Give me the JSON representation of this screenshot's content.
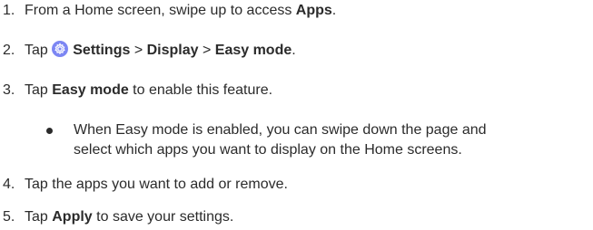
{
  "steps": [
    {
      "number": "1.",
      "prefix": "From a Home screen, swipe up to access ",
      "bold": "Apps",
      "suffix": "."
    },
    {
      "number": "2.",
      "prefix": "Tap ",
      "icon": "settings-gear-icon",
      "icon_color": "#7c86f3",
      "path": [
        "Settings",
        "Display",
        "Easy mode"
      ],
      "separator": " > ",
      "suffix": "."
    },
    {
      "number": "3.",
      "prefix": "Tap ",
      "bold": "Easy mode",
      "suffix": " to enable this feature."
    },
    {
      "number": "4.",
      "text": "Tap the apps you want to add or remove."
    },
    {
      "number": "5.",
      "prefix": "Tap ",
      "bold": "Apply",
      "suffix": " to save your settings."
    }
  ],
  "sub_bullet": {
    "line1": "When Easy mode is enabled, you can swipe down the page and",
    "line2": "select which apps you want to display on the Home screens."
  }
}
